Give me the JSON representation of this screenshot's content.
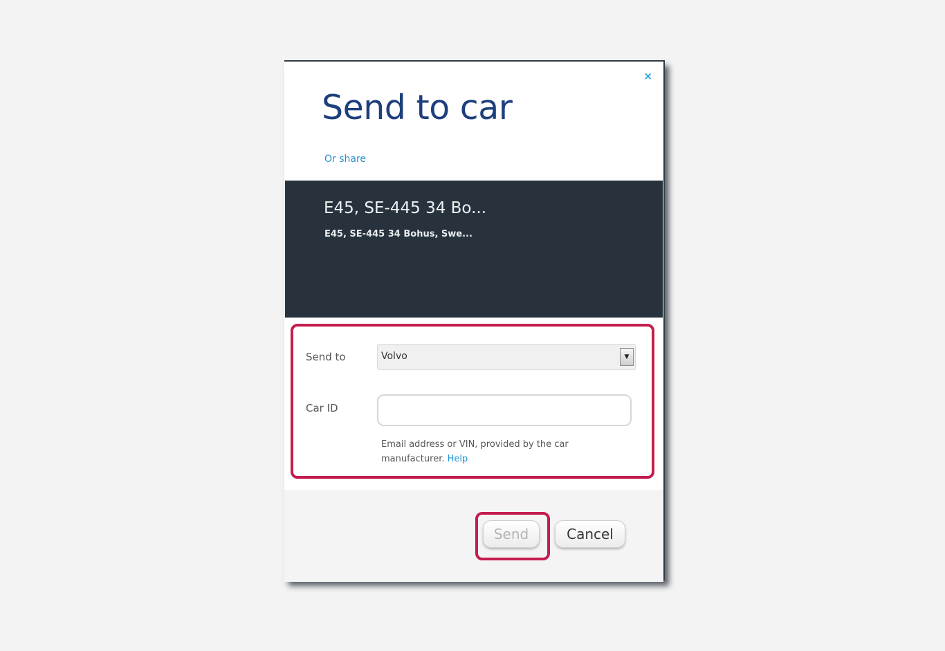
{
  "dialog": {
    "title": "Send to car",
    "close_glyph": "×",
    "share_link": "Or share"
  },
  "location": {
    "title": "E45, SE-445 34 Bo...",
    "subtitle": "E45, SE-445 34 Bohus, Swe..."
  },
  "form": {
    "send_to_label": "Send to",
    "send_to_value": "Volvo",
    "dropdown_arrow": "▼",
    "car_id_label": "Car ID",
    "car_id_value": "",
    "hint_text": "Email address or VIN, provided by the car manufacturer.",
    "help_link": "Help"
  },
  "buttons": {
    "send": "Send",
    "cancel": "Cancel"
  },
  "colors": {
    "title": "#1e3f7d",
    "link": "#1f95d8",
    "location_bg": "#27323c",
    "highlight": "#c41d4e"
  }
}
